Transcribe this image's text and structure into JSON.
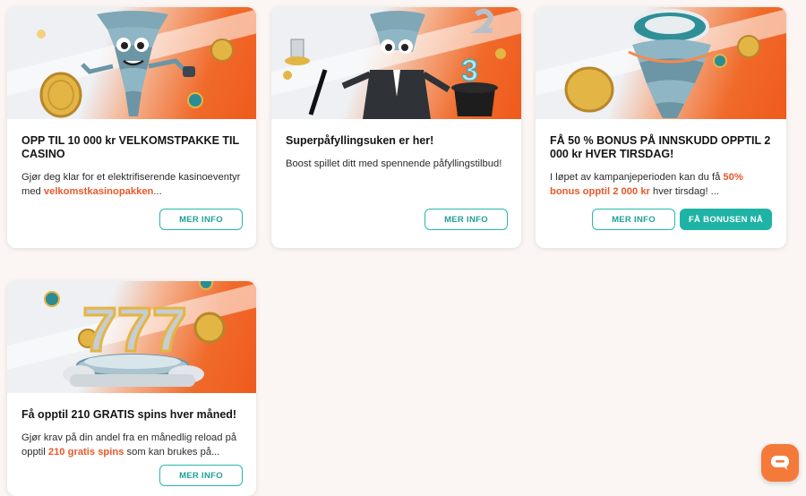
{
  "cards": [
    {
      "title": "OPP TIL 10 000 kr VELKOMSTPAKKE TIL CASINO",
      "desc_pre": "Gjør deg klar for et elektrifiserende kasinoeventyr med ",
      "desc_hl": "velkomstkasinopakken",
      "desc_post": "...",
      "more_label": "MER INFO",
      "banner_icon": "tornado-mascot-coins-icon"
    },
    {
      "title": "Superpåfyllingsuken er her!",
      "desc": "Boost spillet ditt med spennende påfyllingstilbud!",
      "more_label": "MER INFO",
      "banner_icon": "tornado-magician-mascot-icon"
    },
    {
      "title": "FÅ 50 % BONUS PÅ INNSKUDD OPPTIL 2 000 kr HVER TIRSDAG!",
      "desc_pre": "I løpet av kampanjeperioden kan du få ",
      "desc_hl": "50% bonus opptil 2 000 kr",
      "desc_post": " hver tirsdag! ...",
      "more_label": "MER INFO",
      "cta_label": "FÅ BONUSEN NÅ",
      "banner_icon": "casino-chip-tornado-icon"
    },
    {
      "title": "Få opptil 210 GRATIS spins hver måned!",
      "desc_pre": "Gjør krav på din andel fra en månedlig reload på opptil ",
      "desc_hl": "210 gratis spins",
      "desc_post": " som kan brukes på...",
      "more_label": "MER INFO",
      "banner_icon": "lucky-777-icon"
    }
  ],
  "chat": {
    "icon": "chat-bubble-icon"
  },
  "colors": {
    "accent": "#1fb3a5",
    "highlight": "#e8582a",
    "brand_orange": "#f06a2a"
  }
}
